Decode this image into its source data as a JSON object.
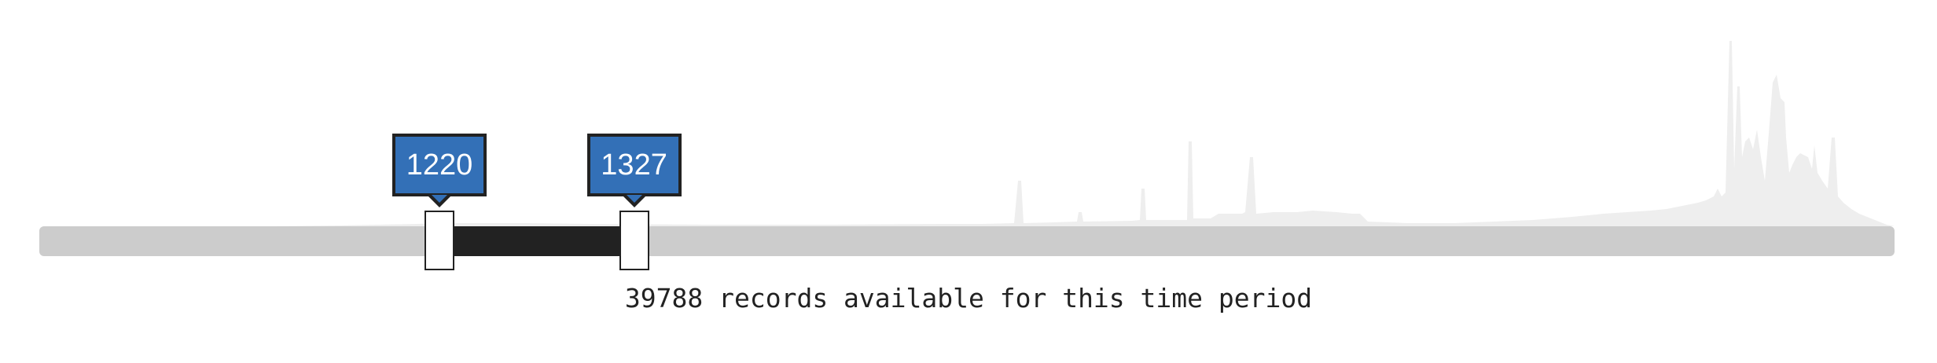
{
  "slider": {
    "min_label": "1220",
    "max_label": "1327",
    "min_value": 1220,
    "max_value": 1327,
    "domain": [
      1000,
      2020
    ]
  },
  "caption": "39788 records available for this time period",
  "colors": {
    "track": "#cccccc",
    "range": "#222222",
    "tooltip_bg": "#3370b7",
    "histogram": "#eeeeee"
  }
}
